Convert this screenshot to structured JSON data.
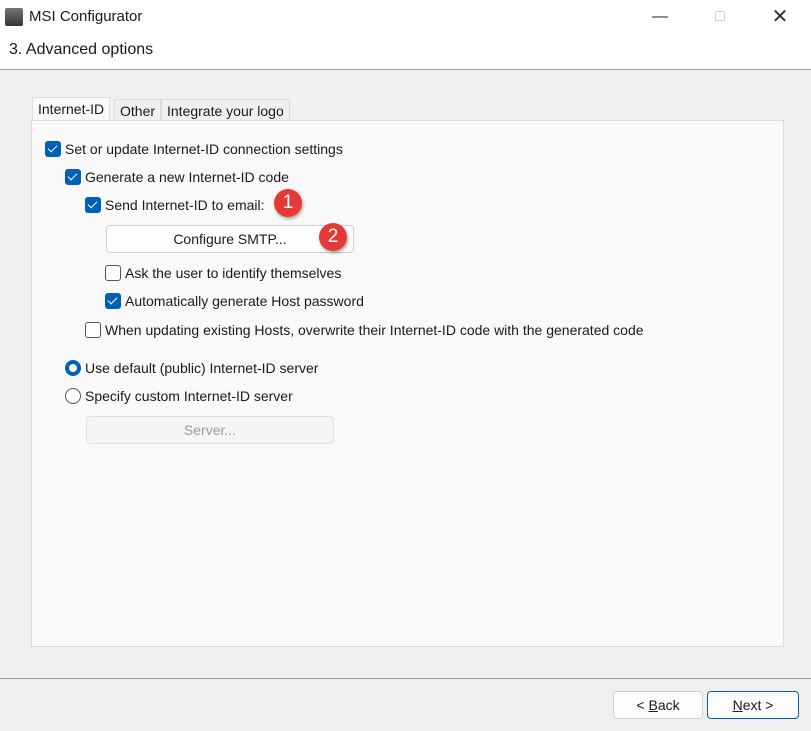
{
  "window": {
    "title": "MSI Configurator",
    "icon": "installer-icon"
  },
  "header": {
    "title": "3. Advanced options"
  },
  "tabs": [
    {
      "label": "Internet-ID",
      "active": true
    },
    {
      "label": "Other"
    },
    {
      "label": "Integrate your logo"
    }
  ],
  "options": {
    "set_update": {
      "label": "Set or update Internet-ID connection settings",
      "checked": true
    },
    "generate_new": {
      "label": "Generate a new Internet-ID code",
      "checked": true
    },
    "send_email": {
      "label": "Send Internet-ID to email:",
      "checked": true
    },
    "configure_smtp": "Configure SMTP...",
    "ask_user": {
      "label": "Ask the user to identify themselves",
      "checked": false
    },
    "auto_password": {
      "label": "Automatically generate Host password",
      "checked": true
    },
    "overwrite": {
      "label": "When updating existing Hosts, overwrite their Internet-ID code with the generated code",
      "checked": false
    },
    "default_server": {
      "label": "Use default (public) Internet-ID server",
      "selected": true
    },
    "custom_server": {
      "label": "Specify custom Internet-ID server",
      "selected": false
    },
    "server_button": "Server..."
  },
  "annotations": [
    "1",
    "2"
  ],
  "footer": {
    "back_prefix": "< ",
    "back_key": "B",
    "back_rest": "ack",
    "next_key": "N",
    "next_rest": "ext >"
  },
  "colors": {
    "accent": "#005fb8",
    "badge": "#e53935"
  }
}
